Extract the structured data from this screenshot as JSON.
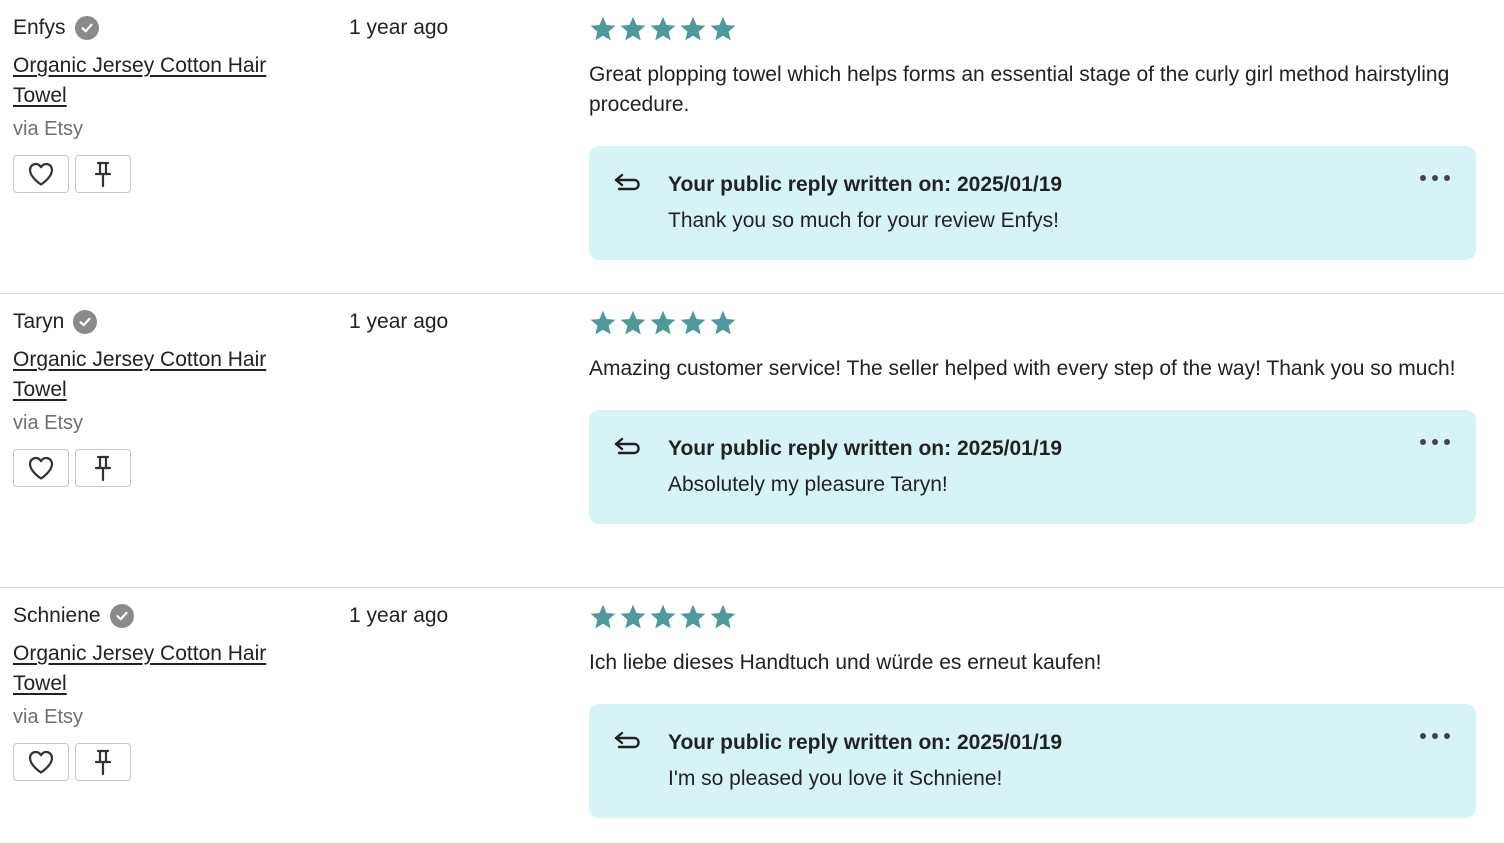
{
  "colors": {
    "star": "#4d9a9c",
    "reply_background": "#d6f4f6",
    "verified_badge": "#8a8a8a"
  },
  "reviews": [
    {
      "name": "Enfys",
      "product": "Organic Jersey Cotton Hair Towel",
      "source": "via Etsy",
      "date": "1 year ago",
      "rating": 5,
      "text": "Great plopping towel which helps forms an essential stage of the curly girl method hairstyling procedure.",
      "reply_heading": "Your public reply written on: 2025/01/19",
      "reply_text": "Thank you so much for your review Enfys!"
    },
    {
      "name": "Taryn",
      "product": "Organic Jersey Cotton Hair Towel",
      "source": "via Etsy",
      "date": "1 year ago",
      "rating": 5,
      "text": "Amazing customer service! The seller helped with every step of the way! Thank you so much!",
      "reply_heading": "Your public reply written on: 2025/01/19",
      "reply_text": "Absolutely my pleasure Taryn!"
    },
    {
      "name": "Schniene",
      "product": "Organic Jersey Cotton Hair Towel",
      "source": "via Etsy",
      "date": "1 year ago",
      "rating": 5,
      "text": "Ich liebe dieses Handtuch und würde es erneut kaufen!",
      "reply_heading": "Your public reply written on: 2025/01/19",
      "reply_text": "I'm so pleased you love it Schniene!"
    }
  ]
}
